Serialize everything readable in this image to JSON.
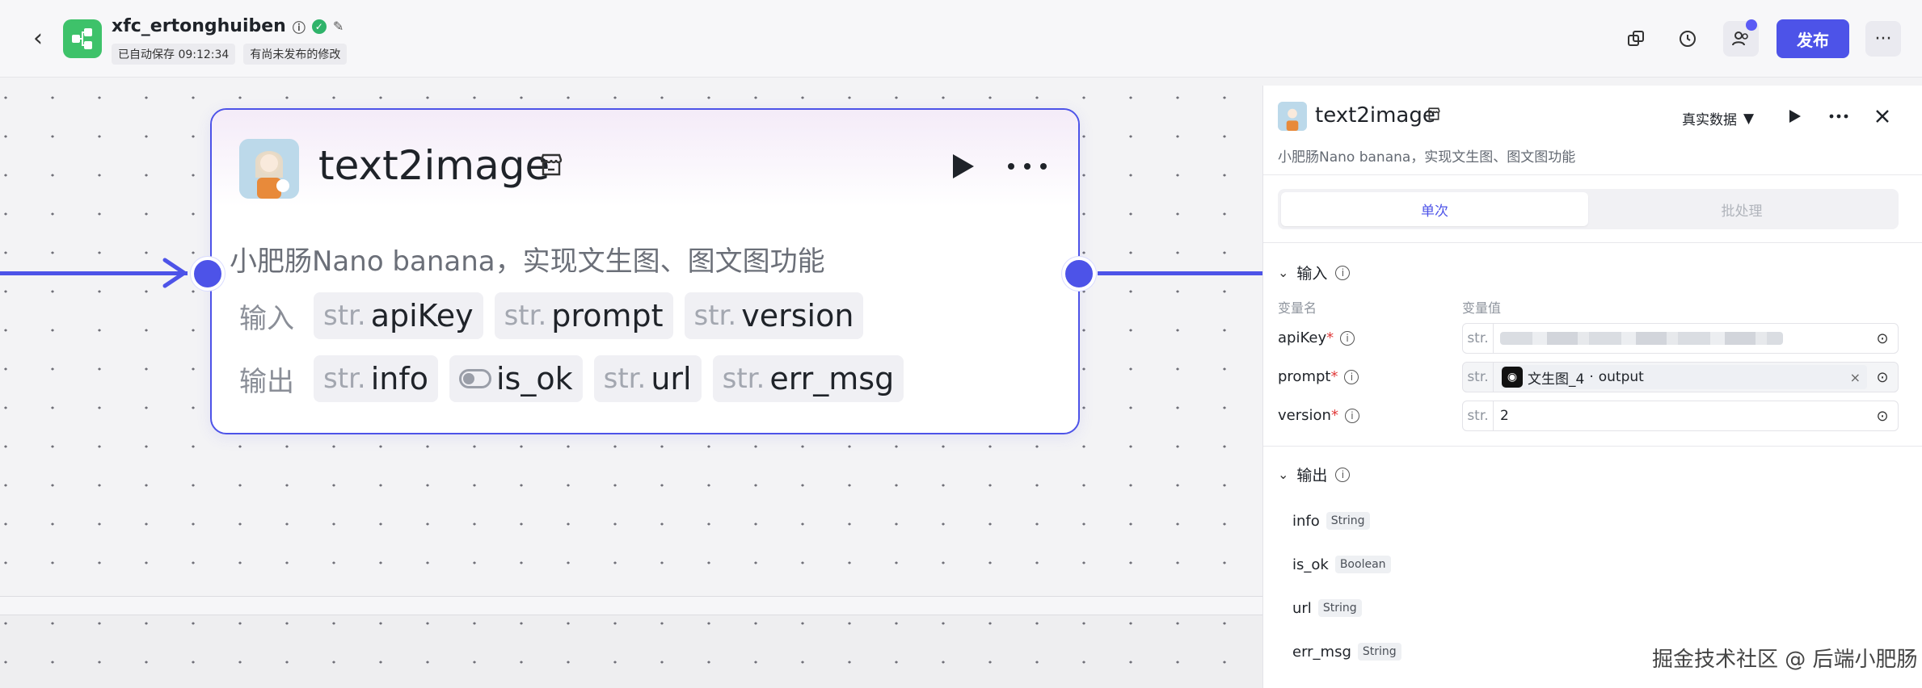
{
  "header": {
    "app_name": "xfc_ertonghuiben",
    "autosave": "已自动保存 09:12:34",
    "unpublished": "有尚未发布的修改",
    "publish_label": "发布"
  },
  "node": {
    "title": "text2image",
    "description": "小肥肠Nano banana，实现文生图、图文图功能",
    "input_label": "输入",
    "output_label": "输出",
    "inputs": [
      {
        "type": "str.",
        "name": "apiKey"
      },
      {
        "type": "str.",
        "name": "prompt"
      },
      {
        "type": "str.",
        "name": "version"
      }
    ],
    "outputs": [
      {
        "type": "str.",
        "name": "info"
      },
      {
        "type": "",
        "name": "is_ok"
      },
      {
        "type": "str.",
        "name": "url"
      },
      {
        "type": "str.",
        "name": "err_msg"
      }
    ]
  },
  "panel": {
    "title": "text2image",
    "data_mode": "真实数据",
    "description": "小肥肠Nano banana，实现文生图、图文图功能",
    "tabs": [
      "单次",
      "批处理"
    ],
    "input_section": "输入",
    "col_name": "变量名",
    "col_value": "变量值",
    "vars": [
      {
        "name": "apiKey",
        "type": "str.",
        "value": ""
      },
      {
        "name": "prompt",
        "type": "str.",
        "ref_node": "文生图_4",
        "ref_sep": " · ",
        "ref_field": "output"
      },
      {
        "name": "version",
        "type": "str.",
        "value": "2"
      }
    ],
    "output_section": "输出",
    "outputs": [
      {
        "name": "info",
        "type": "String"
      },
      {
        "name": "is_ok",
        "type": "Boolean"
      },
      {
        "name": "url",
        "type": "String"
      },
      {
        "name": "err_msg",
        "type": "String"
      }
    ]
  },
  "watermark": "掘金技术社区 @ 后端小肥肠",
  "colors": {
    "accent": "#4d53e8",
    "logo": "#3ec26a",
    "required": "#e03a3a"
  }
}
